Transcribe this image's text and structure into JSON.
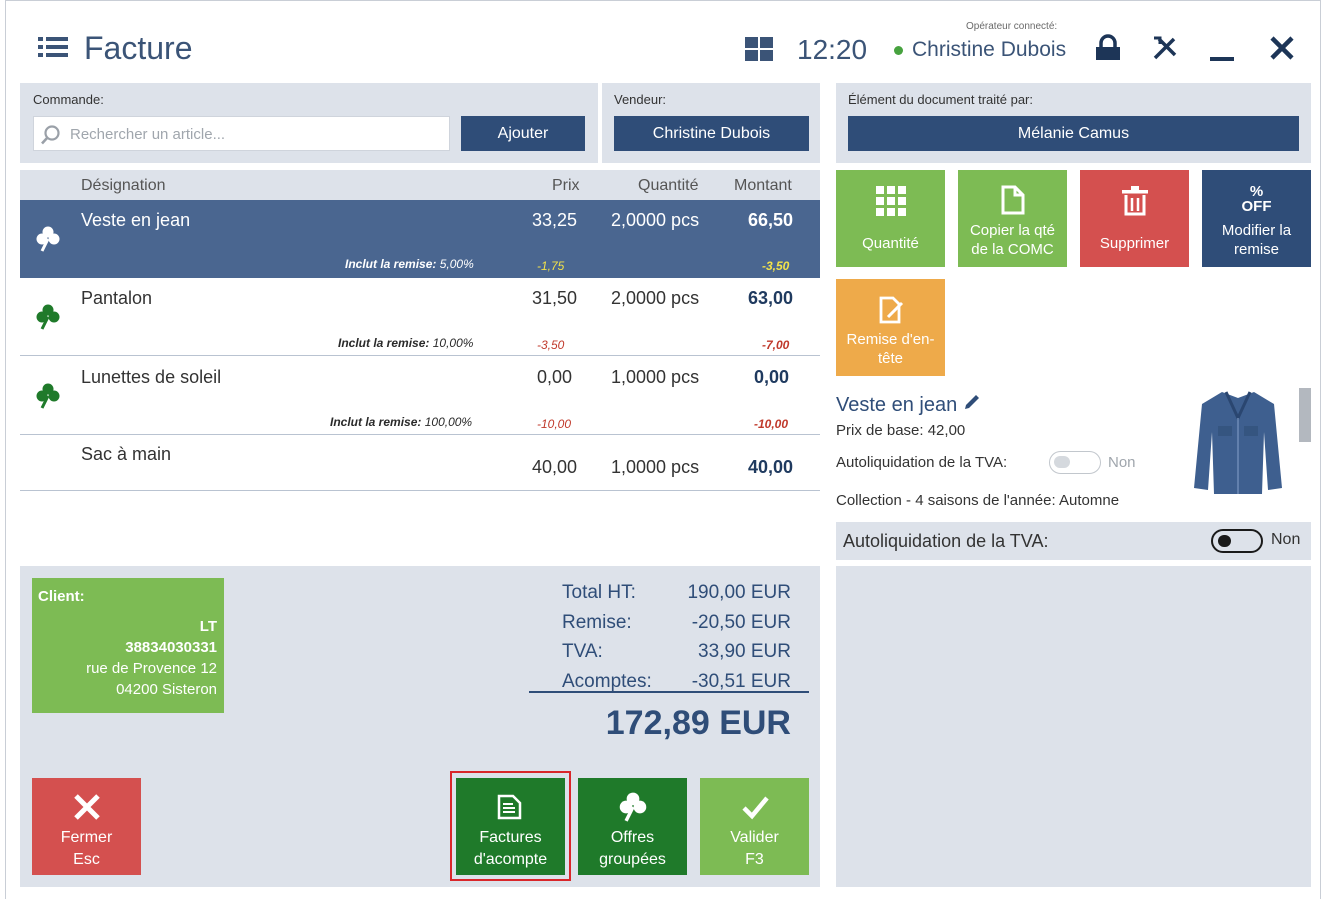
{
  "header": {
    "title": "Facture",
    "time": "12:20",
    "operator_label": "Opérateur connecté:",
    "operator_name": "Christine Dubois"
  },
  "order": {
    "label": "Commande:",
    "search_placeholder": "Rechercher un article...",
    "add_label": "Ajouter"
  },
  "seller": {
    "label": "Vendeur:",
    "name": "Christine Dubois"
  },
  "processed_by": {
    "label": "Élément du document traité par:",
    "name": "Mélanie Camus"
  },
  "table": {
    "headers": {
      "designation": "Désignation",
      "price": "Prix",
      "qty": "Quantité",
      "amount": "Montant"
    },
    "rows": [
      {
        "name": "Veste en jean",
        "price": "33,25",
        "qty": "2,0000 pcs",
        "amount": "66,50",
        "discount_label": "Inclut la remise:",
        "discount_pct": "5,00%",
        "price_disc": "-1,75",
        "amount_disc": "-3,50"
      },
      {
        "name": "Pantalon",
        "price": "31,50",
        "qty": "2,0000 pcs",
        "amount": "63,00",
        "discount_label": "Inclut la remise:",
        "discount_pct": "10,00%",
        "price_disc": "-3,50",
        "amount_disc": "-7,00"
      },
      {
        "name": "Lunettes de soleil",
        "price": "0,00",
        "qty": "1,0000 pcs",
        "amount": "0,00",
        "discount_label": "Inclut la remise:",
        "discount_pct": "100,00%",
        "price_disc": "-10,00",
        "amount_disc": "-10,00"
      },
      {
        "name": "Sac à main",
        "price": "40,00",
        "qty": "1,0000 pcs",
        "amount": "40,00"
      }
    ]
  },
  "actions": {
    "quantity": "Quantité",
    "copy_qty_1": "Copier la qté",
    "copy_qty_2": "de la COMC",
    "delete": "Supprimer",
    "discount_icon_1": "%",
    "discount_icon_2": "OFF",
    "modify_discount_1": "Modifier la",
    "modify_discount_2": "remise",
    "header_discount_1": "Remise d'en-",
    "header_discount_2": "tête"
  },
  "item_detail": {
    "name": "Veste en jean",
    "base_price": "Prix de base: 42,00",
    "reverse_charge_label": "Autoliquidation de la TVA:",
    "reverse_charge_value": "Non",
    "collection": "Collection - 4 saisons de l'année: Automne"
  },
  "doc_reverse_charge": {
    "label": "Autoliquidation de la TVA:",
    "value": "Non"
  },
  "client": {
    "label": "Client:",
    "code": "LT",
    "number": "38834030331",
    "street": "rue de Provence 12",
    "city": "04200 Sisteron"
  },
  "totals": {
    "net_label": "Total HT:",
    "net_value": "190,00 EUR",
    "discount_label": "Remise:",
    "discount_value": "-20,50 EUR",
    "vat_label": "TVA:",
    "vat_value": "33,90 EUR",
    "advance_label": "Acomptes:",
    "advance_value": "-30,51 EUR",
    "grand_total": "172,89 EUR"
  },
  "buttons": {
    "close_1": "Fermer",
    "close_2": "Esc",
    "advance_1": "Factures",
    "advance_2": "d'acompte",
    "offers_1": "Offres",
    "offers_2": "groupées",
    "validate_1": "Valider",
    "validate_2": "F3"
  },
  "colors": {
    "navy": "#2f4d78",
    "selected_row": "#4a6690",
    "green_light": "#7dbb54",
    "green_dark": "#1f7a2a",
    "red": "#d4504f",
    "orange": "#eeaa4a"
  }
}
